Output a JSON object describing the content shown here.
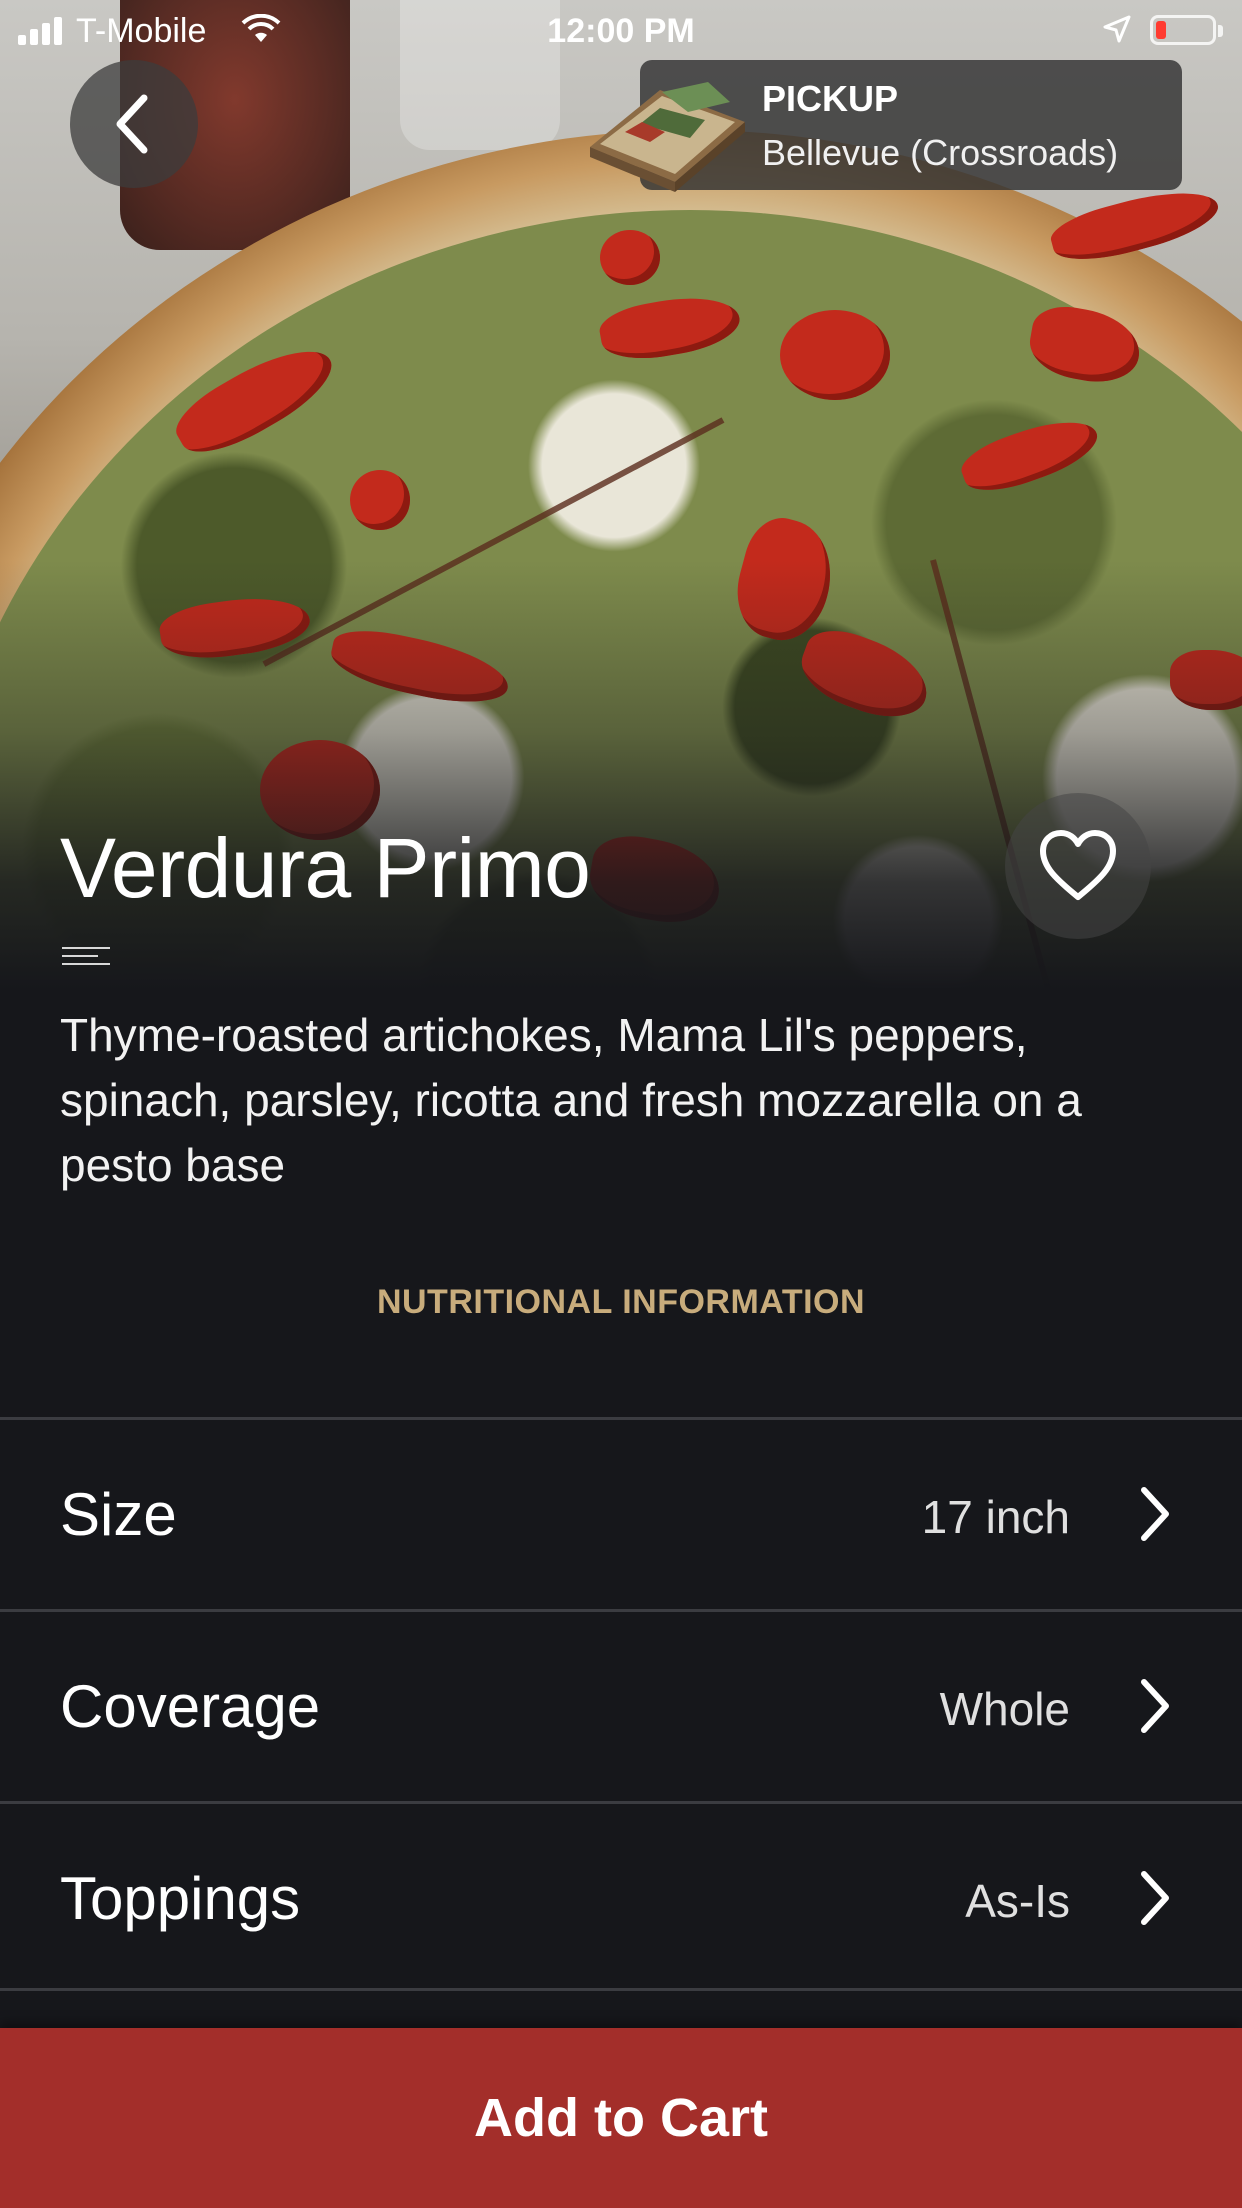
{
  "status_bar": {
    "carrier": "T-Mobile",
    "time": "12:00 PM",
    "battery_color": "#ff3b30"
  },
  "header": {
    "back_icon": "chevron-left-icon",
    "order_mode": "PICKUP",
    "location": "Bellevue (Crossroads)",
    "box_icon": "pizza-box-icon"
  },
  "product": {
    "name": "Verdura Primo",
    "favorite_icon": "heart-outline-icon",
    "description": "Thyme-roasted artichokes, Mama Lil's peppers, spinach, parsley, ricotta and fresh mozzarella on a pesto base",
    "nutrition_link": "NUTRITIONAL INFORMATION"
  },
  "options": [
    {
      "label": "Size",
      "value": "17 inch"
    },
    {
      "label": "Coverage",
      "value": "Whole"
    },
    {
      "label": "Toppings",
      "value": "As-Is"
    }
  ],
  "cart": {
    "label": "Add to Cart",
    "color": "#a32e2a"
  },
  "theme": {
    "background": "#16171b",
    "accent": "#c8ac7c"
  }
}
